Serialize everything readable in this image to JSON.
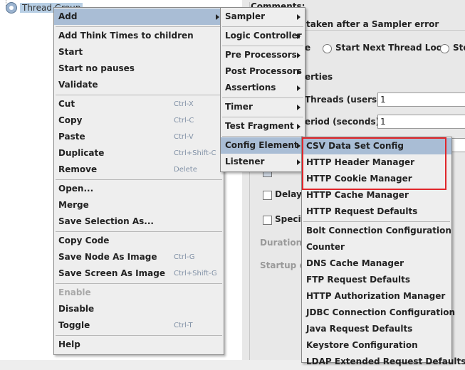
{
  "tree": {
    "node_label": "Thread Group"
  },
  "panel": {
    "comments_label": "Comments:",
    "error_label": "taken after a Sampler error",
    "radio_partial": "e",
    "radio_start_next": "Start Next Thread Loop",
    "radio_stop": "Sto",
    "properties_label": "erties",
    "threads_label": "Threads (users):",
    "threads_value": "1",
    "period_label": "eriod (seconds):",
    "period_value": "1",
    "delay_label": "Delay T",
    "specify_label": "Specif",
    "duration_label": "Duration (s",
    "startup_label": "Startup de"
  },
  "main_menu": {
    "add": "Add",
    "add_think_times": "Add Think Times to children",
    "start": "Start",
    "start_no_pauses": "Start no pauses",
    "validate": "Validate",
    "cut": "Cut",
    "cut_sc": "Ctrl-X",
    "copy": "Copy",
    "copy_sc": "Ctrl-C",
    "paste": "Paste",
    "paste_sc": "Ctrl-V",
    "duplicate": "Duplicate",
    "duplicate_sc": "Ctrl+Shift-C",
    "remove": "Remove",
    "remove_sc": "Delete",
    "open": "Open...",
    "merge": "Merge",
    "save_selection": "Save Selection As...",
    "copy_code": "Copy Code",
    "save_node_image": "Save Node As Image",
    "save_node_image_sc": "Ctrl-G",
    "save_screen_image": "Save Screen As Image",
    "save_screen_image_sc": "Ctrl+Shift-G",
    "enable": "Enable",
    "disable": "Disable",
    "toggle": "Toggle",
    "toggle_sc": "Ctrl-T",
    "help": "Help"
  },
  "add_menu": {
    "sampler": "Sampler",
    "logic_controller": "Logic Controller",
    "pre_processors": "Pre Processors",
    "post_processors": "Post Processors",
    "assertions": "Assertions",
    "timer": "Timer",
    "test_fragment": "Test Fragment",
    "config_element": "Config Element",
    "listener": "Listener"
  },
  "config_menu": {
    "items": [
      "CSV Data Set Config",
      "HTTP Header Manager",
      "HTTP Cookie Manager",
      "HTTP Cache Manager",
      "HTTP Request Defaults",
      "Bolt Connection Configuration",
      "Counter",
      "DNS Cache Manager",
      "FTP Request Defaults",
      "HTTP Authorization Manager",
      "JDBC Connection Configuration",
      "Java Request Defaults",
      "Keystore Configuration",
      "LDAP Extended Request Defaults"
    ]
  },
  "colors": {
    "selection": "#a9bdd5",
    "highlight_box": "#e0262b"
  }
}
